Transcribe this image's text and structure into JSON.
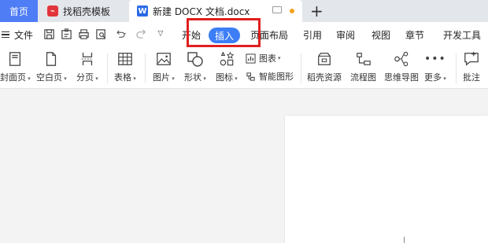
{
  "tabs": {
    "home": "首页",
    "daoke": "找稻壳模板",
    "doc": "新建 DOCX 文档.docx"
  },
  "menu": {
    "file": "文件",
    "items": [
      "开始",
      "插入",
      "页面布局",
      "引用",
      "审阅",
      "视图",
      "章节",
      "开发工具"
    ],
    "active": "插入"
  },
  "ribbon": {
    "cover": "封面页",
    "blank": "空白页",
    "pagebreak": "分页",
    "table": "表格",
    "picture": "图片",
    "shape": "形状",
    "icon": "图标",
    "chart": "图表",
    "smartart": "智能图形",
    "daoke_res": "稻壳资源",
    "flowchart": "流程图",
    "mindmap": "思维导图",
    "more": "更多",
    "comment": "批注"
  },
  "colors": {
    "accent": "#3d7ef6",
    "home_tab": "#4f7df5",
    "highlight": "#e01f1f",
    "status_dot": "#f2a31b"
  }
}
